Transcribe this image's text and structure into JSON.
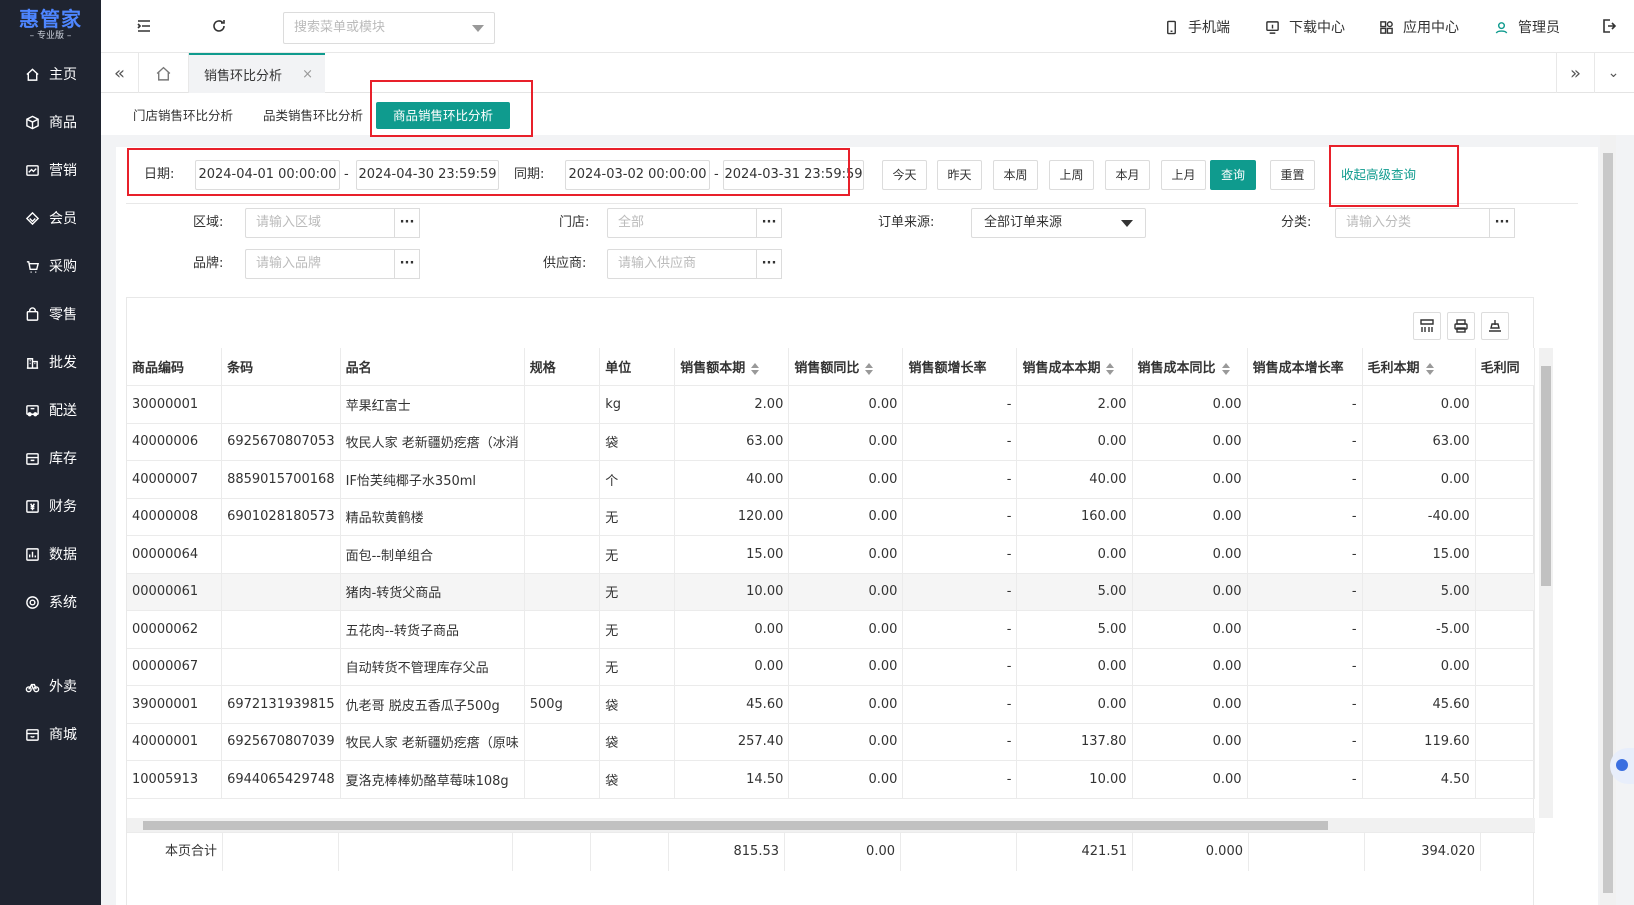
{
  "brand": {
    "name": "惠管家",
    "edition": "– 专业版 –"
  },
  "sidebar": {
    "items": [
      {
        "label": "主页",
        "icon": "home-icon"
      },
      {
        "label": "商品",
        "icon": "box-icon"
      },
      {
        "label": "营销",
        "icon": "chart-icon"
      },
      {
        "label": "会员",
        "icon": "diamond-icon"
      },
      {
        "label": "采购",
        "icon": "cart-icon"
      },
      {
        "label": "零售",
        "icon": "bag-icon"
      },
      {
        "label": "批发",
        "icon": "building-icon"
      },
      {
        "label": "配送",
        "icon": "truck-icon"
      },
      {
        "label": "库存",
        "icon": "warehouse-icon"
      },
      {
        "label": "财务",
        "icon": "money-icon"
      },
      {
        "label": "数据",
        "icon": "data-icon"
      },
      {
        "label": "系统",
        "icon": "gear-icon"
      }
    ],
    "extra": [
      {
        "label": "外卖",
        "icon": "bike-icon"
      },
      {
        "label": "商城",
        "icon": "store-icon"
      }
    ]
  },
  "topbar": {
    "search_placeholder": "搜索菜单或模块",
    "mobile": "手机端",
    "download": "下载中心",
    "apps": "应用中心",
    "user": "管理员"
  },
  "tabs": {
    "active": "销售环比分析",
    "close": "×"
  },
  "subtabs": [
    "门店销售环比分析",
    "品类销售环比分析",
    "商品销售环比分析"
  ],
  "filters": {
    "date_label": "日期:",
    "date_start": "2024-04-01 00:00:00",
    "date_end": "2024-04-30 23:59:59",
    "same_label": "同期:",
    "same_start": "2024-03-02 00:00:00",
    "same_end": "2024-03-31 23:59:59",
    "dash": "-",
    "quick": [
      "今天",
      "昨天",
      "本周",
      "上周",
      "本月",
      "上月"
    ],
    "query": "查询",
    "reset": "重置",
    "collapse": "收起高级查询",
    "region_label": "区域:",
    "region_ph": "请输入区域",
    "store_label": "门店:",
    "store_ph": "全部",
    "source_label": "订单来源:",
    "source_value": "全部订单来源",
    "category_label": "分类:",
    "category_ph": "请输入分类",
    "brand_label": "品牌:",
    "brand_ph": "请输入品牌",
    "supplier_label": "供应商:",
    "supplier_ph": "请输入供应商",
    "dots": "···"
  },
  "table": {
    "columns": [
      "商品编码",
      "条码",
      "品名",
      "规格",
      "单位",
      "销售额本期",
      "销售额同比",
      "销售额增长率",
      "销售成本本期",
      "销售成本同比",
      "销售成本增长率",
      "毛利本期",
      "毛利同"
    ],
    "sortable": [
      false,
      false,
      false,
      false,
      false,
      true,
      true,
      false,
      true,
      true,
      false,
      true,
      false
    ],
    "rows": [
      [
        "30000001",
        "",
        "苹果红富士",
        "",
        "kg",
        "2.00",
        "0.00",
        "-",
        "2.00",
        "0.00",
        "-",
        "0.00",
        ""
      ],
      [
        "40000006",
        "6925670807053",
        "牧民人家 老新疆奶疙瘩（冰消",
        "",
        "袋",
        "63.00",
        "0.00",
        "-",
        "0.00",
        "0.00",
        "-",
        "63.00",
        ""
      ],
      [
        "40000007",
        "8859015700168",
        "IF怡芙纯椰子水350ml",
        "",
        "个",
        "40.00",
        "0.00",
        "-",
        "40.00",
        "0.00",
        "-",
        "0.00",
        ""
      ],
      [
        "40000008",
        "6901028180573",
        "精品软黄鹤楼",
        "",
        "无",
        "120.00",
        "0.00",
        "-",
        "160.00",
        "0.00",
        "-",
        "-40.00",
        ""
      ],
      [
        "00000064",
        "",
        "面包--制单组合",
        "",
        "无",
        "15.00",
        "0.00",
        "-",
        "0.00",
        "0.00",
        "-",
        "15.00",
        ""
      ],
      [
        "00000061",
        "",
        "猪肉-转货父商品",
        "",
        "无",
        "10.00",
        "0.00",
        "-",
        "5.00",
        "0.00",
        "-",
        "5.00",
        ""
      ],
      [
        "00000062",
        "",
        "五花肉--转货子商品",
        "",
        "无",
        "0.00",
        "0.00",
        "-",
        "5.00",
        "0.00",
        "-",
        "-5.00",
        ""
      ],
      [
        "00000067",
        "",
        "自动转货不管理库存父品",
        "",
        "无",
        "0.00",
        "0.00",
        "-",
        "0.00",
        "0.00",
        "-",
        "0.00",
        ""
      ],
      [
        "39000001",
        "6972131939815",
        "仇老哥 脱皮五香瓜子500g",
        "500g",
        "袋",
        "45.60",
        "0.00",
        "-",
        "0.00",
        "0.00",
        "-",
        "45.60",
        ""
      ],
      [
        "40000001",
        "6925670807039",
        "牧民人家 老新疆奶疙瘩（原味",
        "",
        "袋",
        "257.40",
        "0.00",
        "-",
        "137.80",
        "0.00",
        "-",
        "119.60",
        ""
      ],
      [
        "10005913",
        "6944065429748",
        "夏洛克棒棒奶酪草莓味108g",
        "",
        "袋",
        "14.50",
        "0.00",
        "-",
        "10.00",
        "0.00",
        "-",
        "4.50",
        ""
      ]
    ],
    "footer": {
      "label": "本页合计",
      "sales": "815.53",
      "sales_yoy": "0.00",
      "cost": "421.51",
      "cost_yoy": "0.000",
      "profit": "394.020"
    }
  },
  "colors": {
    "accent": "#0f9b8e",
    "sidebar": "#1f2430",
    "highlight": "#e8202a"
  }
}
